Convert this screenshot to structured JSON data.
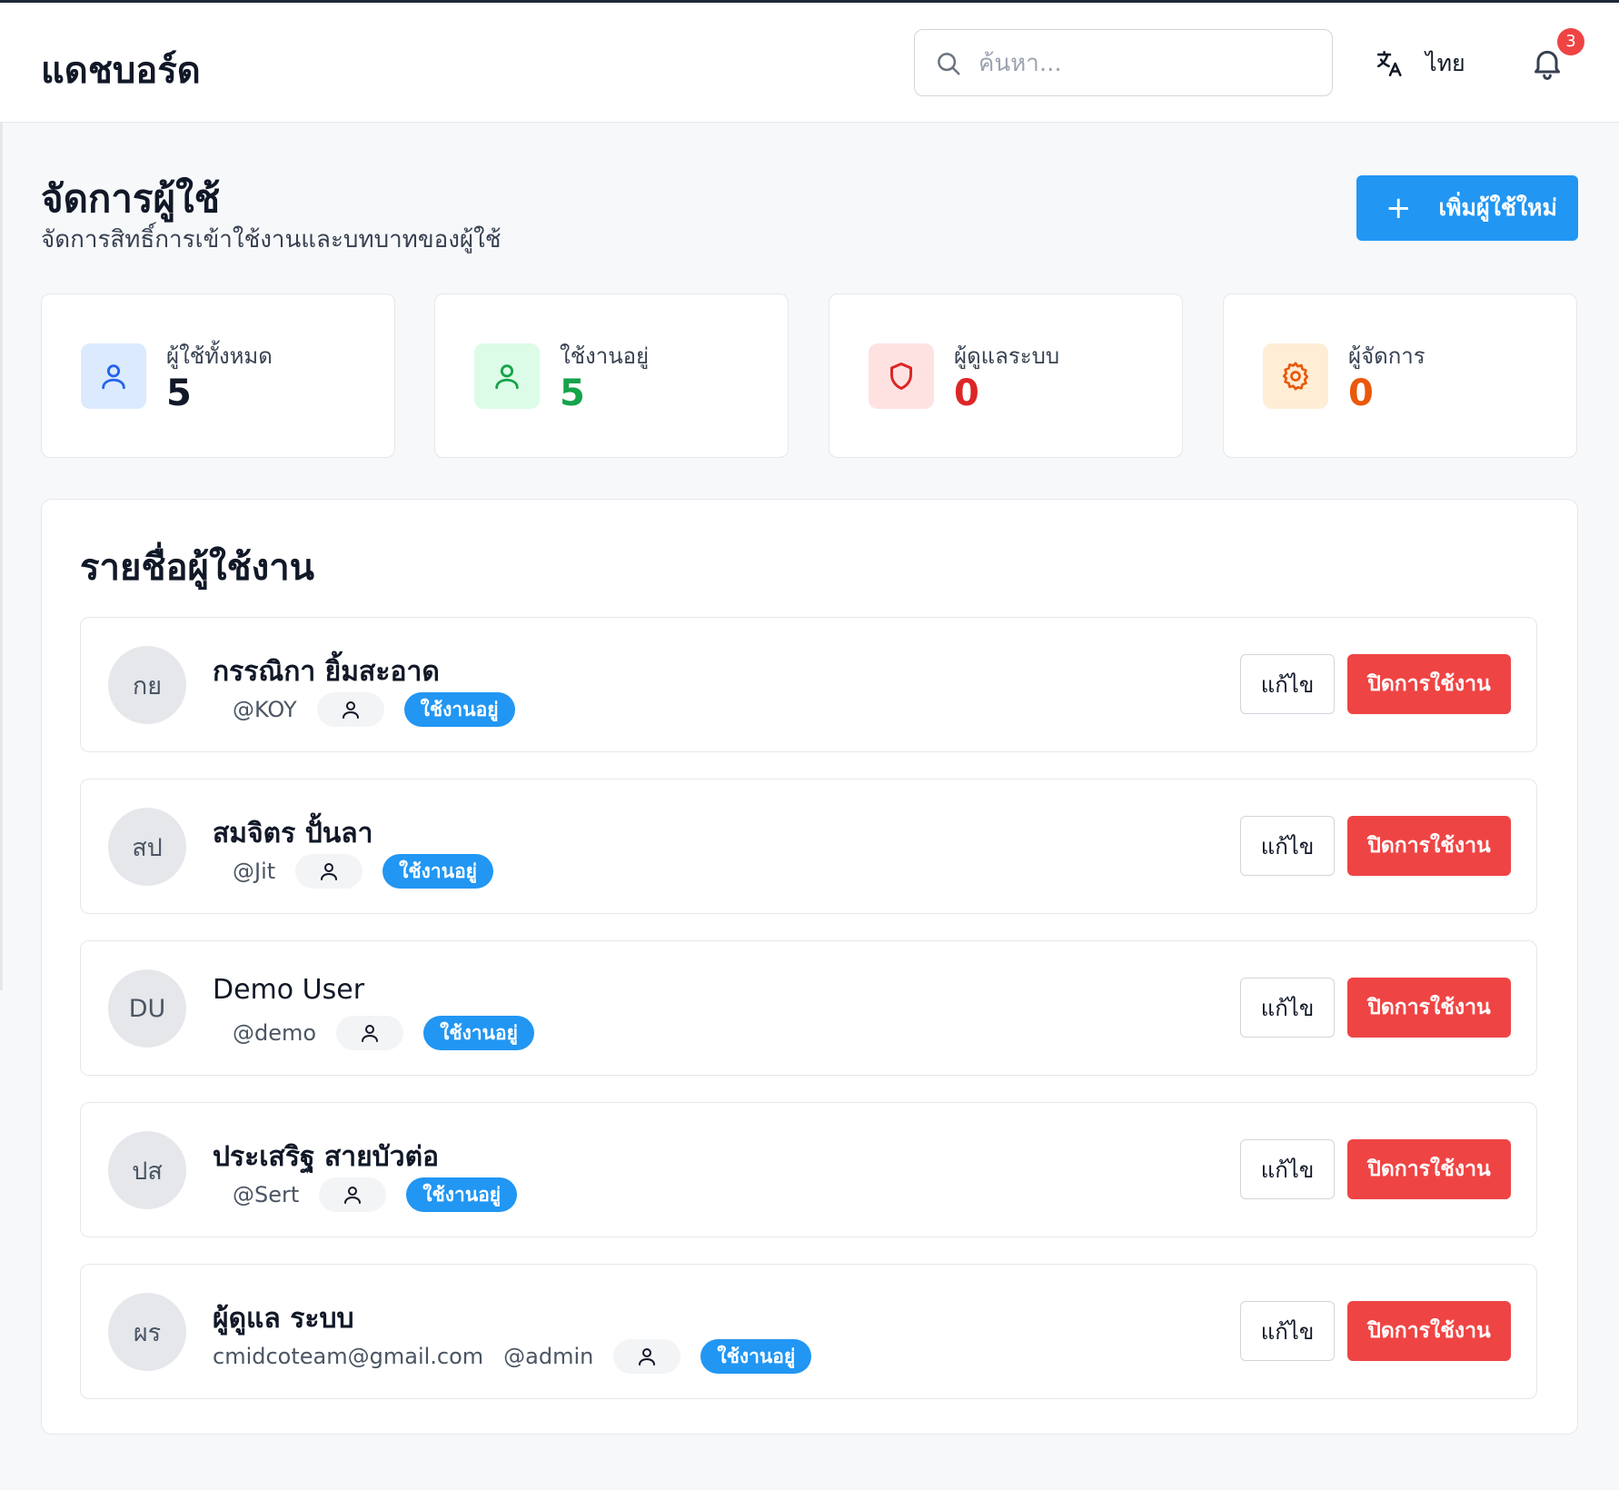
{
  "header": {
    "app_title": "แดชบอร์ด",
    "search_placeholder": "ค้นหา...",
    "language_label": "ไทย",
    "notification_count": "3"
  },
  "page": {
    "title": "จัดการผู้ใช้",
    "subtitle": "จัดการสิทธิ์การเข้าใช้งานและบทบาทของผู้ใช้",
    "add_button_label": "เพิ่มผู้ใช้ใหม่"
  },
  "stats": [
    {
      "label": "ผู้ใช้ทั้งหมด",
      "value": "5",
      "color": "#111827",
      "icon": "user-icon",
      "icon_color": "#2563eb",
      "icon_bg": "#dbeafe"
    },
    {
      "label": "ใช้งานอยู่",
      "value": "5",
      "color": "#16a34a",
      "icon": "user-check-icon",
      "icon_color": "#16a34a",
      "icon_bg": "#dcfce7"
    },
    {
      "label": "ผู้ดูแลระบบ",
      "value": "0",
      "color": "#dc2626",
      "icon": "shield-icon",
      "icon_color": "#dc2626",
      "icon_bg": "#fee2e2"
    },
    {
      "label": "ผู้จัดการ",
      "value": "0",
      "color": "#ea580c",
      "icon": "gear-icon",
      "icon_color": "#ea580c",
      "icon_bg": "#ffedd5"
    }
  ],
  "user_list": {
    "title": "รายชื่อผู้ใช้งาน",
    "edit_label": "แก้ไข",
    "disable_label": "ปิดการใช้งาน",
    "users": [
      {
        "initials": "กย",
        "name": "กรรณิกา ยิ้มสะอาด",
        "email": "",
        "username": "@KOY",
        "status": "ใช้งานอยู่"
      },
      {
        "initials": "สป",
        "name": "สมจิตร ปั้นลา",
        "email": "",
        "username": "@Jit",
        "status": "ใช้งานอยู่"
      },
      {
        "initials": "DU",
        "name": "Demo User",
        "email": "",
        "username": "@demo",
        "status": "ใช้งานอยู่"
      },
      {
        "initials": "ปส",
        "name": "ประเสริฐ สายบัวต่อ",
        "email": "",
        "username": "@Sert",
        "status": "ใช้งานอยู่"
      },
      {
        "initials": "ผร",
        "name": "ผู้ดูแล ระบบ",
        "email": "cmidcoteam@gmail.com",
        "username": "@admin",
        "status": "ใช้งานอยู่"
      }
    ]
  },
  "colors": {
    "primary": "#2196f3",
    "danger": "#ef4444"
  }
}
